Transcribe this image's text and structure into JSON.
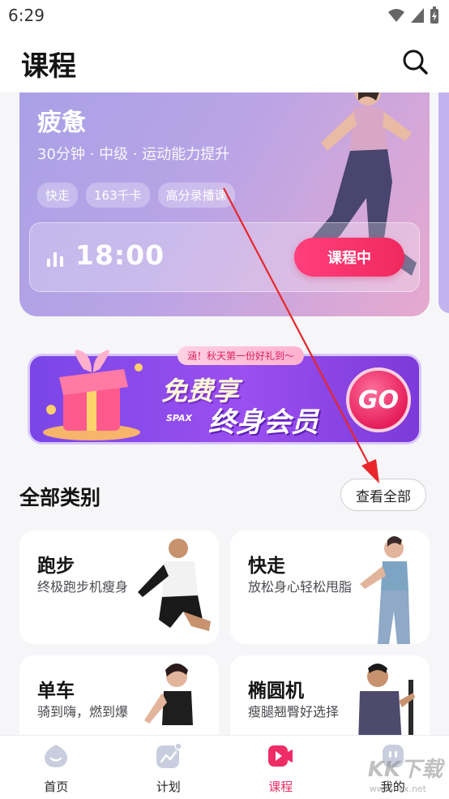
{
  "status_bar": {
    "time": "6:29"
  },
  "header": {
    "title": "课程"
  },
  "hero": {
    "title": "疲惫",
    "subtitle": "30分钟 · 中级 · 运动能力提升",
    "tags": [
      "快走",
      "163千卡",
      "高分录播课"
    ],
    "timer": "18:00",
    "status_button": "课程中"
  },
  "promo": {
    "ribbon": "涵！秋天第一份好礼到～",
    "line1": "免费享",
    "line2": "终身会员",
    "brand": "SPAX",
    "go_label": "GO"
  },
  "categories_section": {
    "title": "全部类别",
    "view_all": "查看全部",
    "items": [
      {
        "title": "跑步",
        "desc": "终极跑步机瘦身"
      },
      {
        "title": "快走",
        "desc": "放松身心轻松甩脂"
      },
      {
        "title": "单车",
        "desc": "骑到嗨，燃到爆"
      },
      {
        "title": "椭圆机",
        "desc": "瘦腿翘臀好选择"
      }
    ]
  },
  "bottom_nav": {
    "items": [
      {
        "label": "首页",
        "icon": "home-icon"
      },
      {
        "label": "计划",
        "icon": "plan-icon"
      },
      {
        "label": "课程",
        "icon": "course-icon",
        "active": true
      },
      {
        "label": "我的",
        "icon": "profile-icon"
      }
    ]
  },
  "watermark": {
    "text": "KK下载",
    "url": "www.kkx.net"
  },
  "colors": {
    "accent": "#ee2c66",
    "hero_start": "#a9a0e6",
    "hero_end": "#e7a9cf",
    "promo": "#8a45ea"
  }
}
